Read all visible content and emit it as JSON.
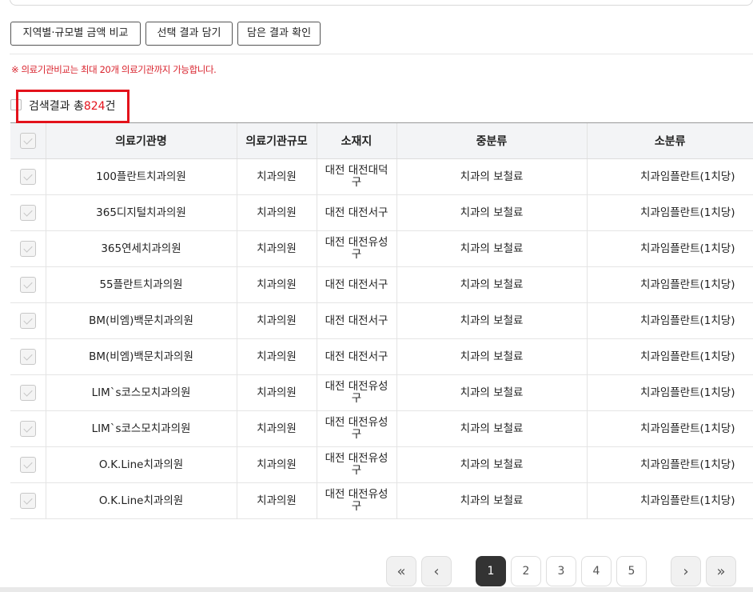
{
  "buttons": {
    "region_compare": "지역별·규모별 금액 비교",
    "add_selected": "선택 결과 담기",
    "view_saved": "담은 결과 확인"
  },
  "notice": "※ 의료기관비교는 최대 20개 의료기관까지 가능합니다.",
  "result": {
    "prefix": "검색결과 총",
    "count": "824",
    "suffix": "건"
  },
  "table": {
    "headers": [
      "의료기관명",
      "의료기관규모",
      "소재지",
      "중분류",
      "소분류"
    ],
    "rows": [
      {
        "name": "100플란트치과의원",
        "size": "치과의원",
        "location": "대전 대전대덕구",
        "mid": "치과의 보철료",
        "sub": "치과임플란트(1치당)"
      },
      {
        "name": "365디지털치과의원",
        "size": "치과의원",
        "location": "대전 대전서구",
        "mid": "치과의 보철료",
        "sub": "치과임플란트(1치당)"
      },
      {
        "name": "365연세치과의원",
        "size": "치과의원",
        "location": "대전 대전유성구",
        "mid": "치과의 보철료",
        "sub": "치과임플란트(1치당)"
      },
      {
        "name": "55플란트치과의원",
        "size": "치과의원",
        "location": "대전 대전서구",
        "mid": "치과의 보철료",
        "sub": "치과임플란트(1치당)"
      },
      {
        "name": "BM(비엠)백문치과의원",
        "size": "치과의원",
        "location": "대전 대전서구",
        "mid": "치과의 보철료",
        "sub": "치과임플란트(1치당)"
      },
      {
        "name": "BM(비엠)백문치과의원",
        "size": "치과의원",
        "location": "대전 대전서구",
        "mid": "치과의 보철료",
        "sub": "치과임플란트(1치당)"
      },
      {
        "name": "LIM`s코스모치과의원",
        "size": "치과의원",
        "location": "대전 대전유성구",
        "mid": "치과의 보철료",
        "sub": "치과임플란트(1치당)"
      },
      {
        "name": "LIM`s코스모치과의원",
        "size": "치과의원",
        "location": "대전 대전유성구",
        "mid": "치과의 보철료",
        "sub": "치과임플란트(1치당)"
      },
      {
        "name": "O.K.Line치과의원",
        "size": "치과의원",
        "location": "대전 대전유성구",
        "mid": "치과의 보철료",
        "sub": "치과임플란트(1치당)"
      },
      {
        "name": "O.K.Line치과의원",
        "size": "치과의원",
        "location": "대전 대전유성구",
        "mid": "치과의 보철료",
        "sub": "치과임플란트(1치당)"
      }
    ]
  },
  "pagination": {
    "first_icon": "double-chevron-left",
    "prev_icon": "chevron-left",
    "pages": [
      "1",
      "2",
      "3",
      "4",
      "5"
    ],
    "current": "1",
    "next_icon": "chevron-right",
    "last_icon": "double-chevron-right",
    "first_glyph": "«",
    "prev_glyph": "‹",
    "next_glyph": "›",
    "last_glyph": "»"
  },
  "colors": {
    "accent_red": "#e3121b",
    "active_page": "#333333"
  }
}
